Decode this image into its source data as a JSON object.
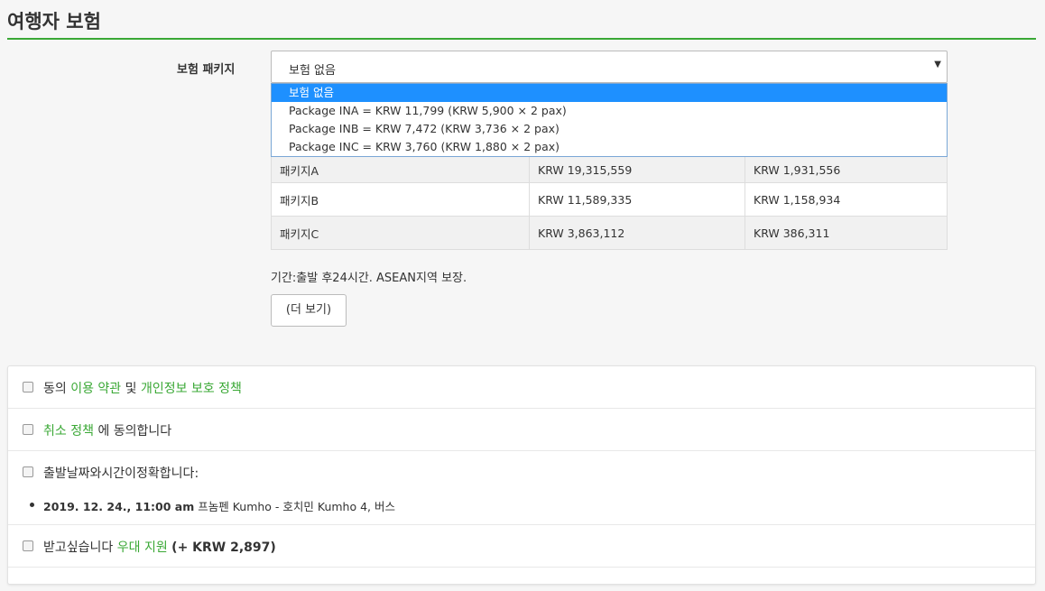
{
  "section_title": "여행자 보험",
  "package_label": "보험 패키지",
  "select": {
    "value": "보험 없음",
    "options": [
      "보험 없음",
      "Package INA = KRW 11,799 (KRW 5,900 × 2 pax)",
      "Package INB = KRW 7,472 (KRW 3,736 × 2 pax)",
      "Package INC = KRW 3,760 (KRW 1,880 × 2 pax)"
    ]
  },
  "table": {
    "rows": [
      [
        "패키지A",
        "KRW 19,315,559",
        "KRW 1,931,556"
      ],
      [
        "패키지B",
        "KRW 11,589,335",
        "KRW 1,158,934"
      ],
      [
        "패키지C",
        "KRW 3,863,112",
        "KRW 386,311"
      ]
    ]
  },
  "note": "기간:출발 후24시간. ASEAN지역 보장.",
  "more_button": "(더 보기)",
  "agreements": {
    "terms": {
      "prefix": "동의",
      "link1": "이용 약관",
      "middle": "및",
      "link2": "개인정보 보호 정책"
    },
    "cancel": {
      "link": "취소 정책",
      "suffix": "에 동의합니다"
    },
    "departure": {
      "label": "출발날짜와시간이정확합니다:",
      "trip_datetime": "2019. 12. 24., 11:00 am",
      "trip_route": "프놈펜 Kumho - 호치민 Kumho 4, 버스"
    },
    "support": {
      "prefix": "받고싶습니다",
      "link": "우대 지원",
      "amount": "(+ KRW 2,897)"
    }
  },
  "colors": {
    "accent_green": "#3aa835",
    "dropdown_highlight": "#1e90ff"
  }
}
